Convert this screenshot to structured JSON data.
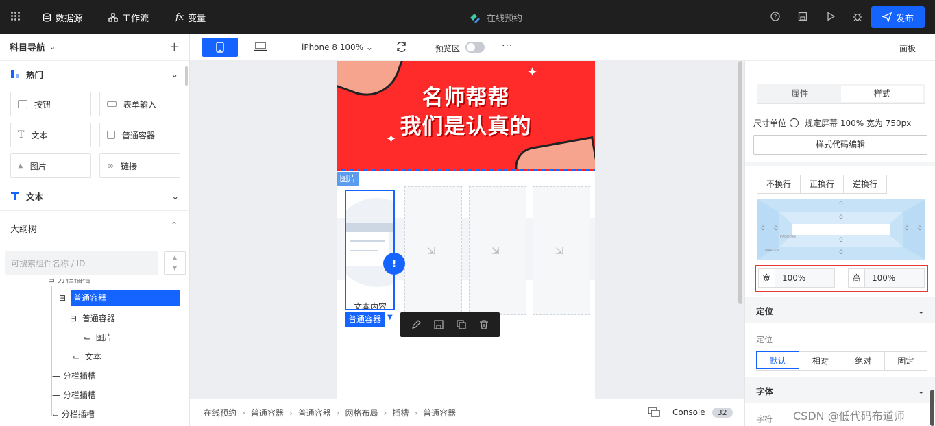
{
  "topbar": {
    "nav": [
      {
        "label": "数据源",
        "icon": "database-icon"
      },
      {
        "label": "工作流",
        "icon": "workflow-icon"
      },
      {
        "label": "变量",
        "icon": "fx-icon"
      }
    ],
    "app_title": "在线预约",
    "publish_label": "发布"
  },
  "left": {
    "header": "科目导航",
    "hot_title": "热门",
    "components": [
      "按钮",
      "表单输入",
      "文本",
      "普通容器",
      "图片",
      "链接"
    ],
    "text_title": "文本",
    "outline_title": "大纲树",
    "search_placeholder": "可搜索组件名称 / ID",
    "tree": {
      "partial": "分栏插槽",
      "selected": "普通容器",
      "child_container": "普通容器",
      "image": "图片",
      "text": "文本",
      "slots": [
        "分栏插槽",
        "分栏插槽",
        "分栏插槽"
      ]
    }
  },
  "toolbar": {
    "device": "iPhone 8 100%",
    "preview_label": "预览区",
    "more": "···",
    "panel_label": "面板"
  },
  "canvas": {
    "banner_line1": "名师帮帮",
    "banner_line2": "我们是认真的",
    "image_tag": "图片",
    "text_content": "文本内容",
    "selected_tag": "普通容器"
  },
  "right": {
    "tabs": [
      "属性",
      "样式"
    ],
    "unit_label": "尺寸单位",
    "unit_value": "规定屏幕 100% 宽为 750px",
    "code_edit": "样式代码编辑",
    "wrap": [
      "不换行",
      "正换行",
      "逆换行"
    ],
    "box": {
      "margin_label": "MARGIN",
      "padding_label": "PADDING",
      "zero": "0"
    },
    "width_label": "宽",
    "width_value": "100%",
    "height_label": "高",
    "height_value": "100%",
    "position_section": "定位",
    "position_label": "定位",
    "position_options": [
      "默认",
      "相对",
      "绝对",
      "固定"
    ],
    "font_section": "字体",
    "font_label": "字符"
  },
  "breadcrumb": [
    "在线预约",
    "普通容器",
    "普通容器",
    "网格布局",
    "插槽",
    "普通容器"
  ],
  "console": {
    "label": "Console",
    "count": "32"
  },
  "watermark": "CSDN @低代码布道师",
  "colors": {
    "accent": "#1664ff",
    "topbar": "#1f1f1f",
    "banner": "#ff2b2b",
    "highlight_box": "#e53935"
  }
}
